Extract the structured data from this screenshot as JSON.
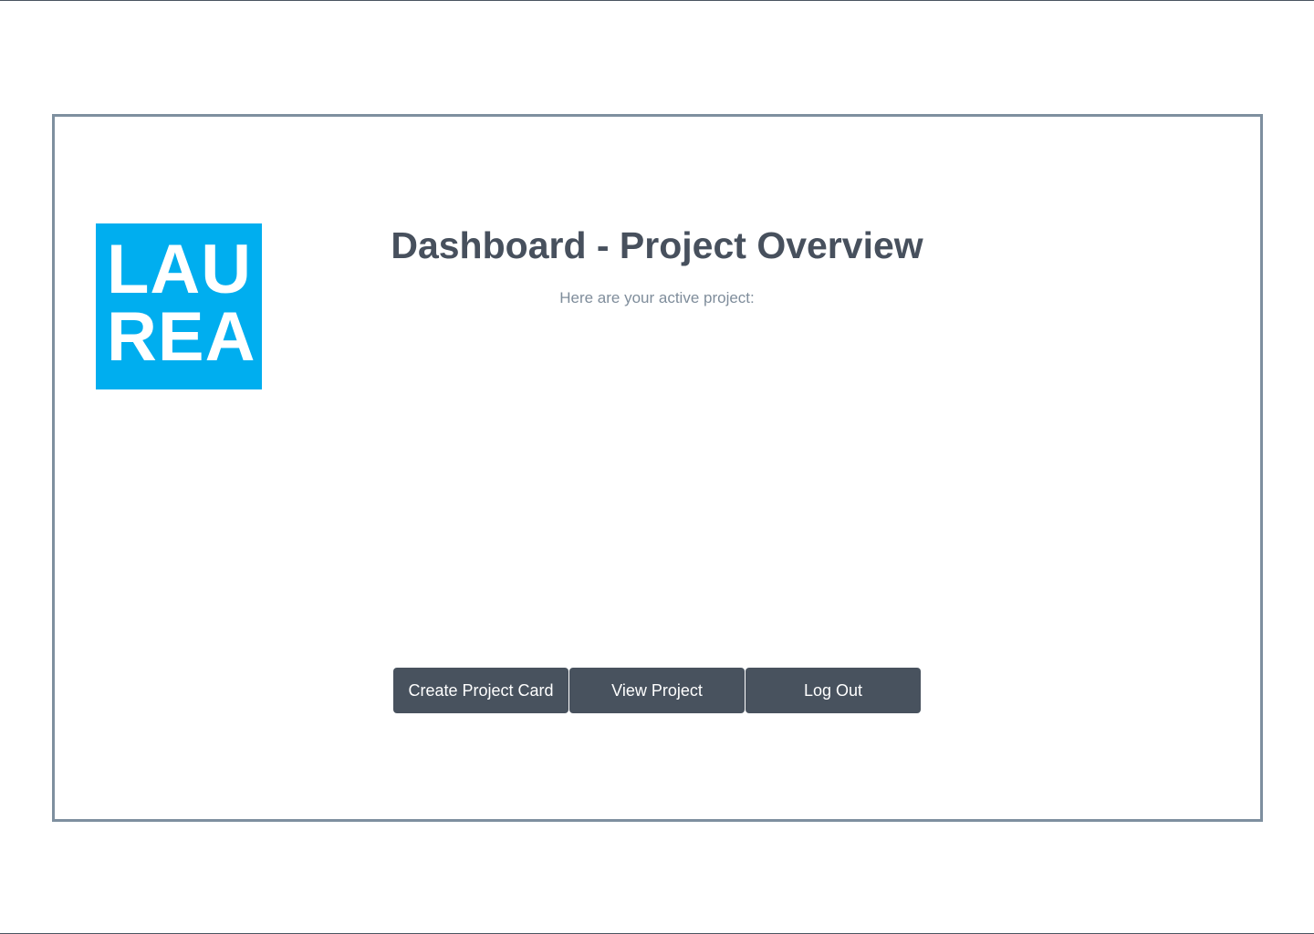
{
  "logo": {
    "line1": "LAU",
    "line2": "REA",
    "color": "#00aeef"
  },
  "header": {
    "title": "Dashboard - Project Overview",
    "subtitle": "Here are your active project:"
  },
  "actions": {
    "create_label": "Create Project Card",
    "view_label": "View Project",
    "logout_label": "Log Out"
  },
  "colors": {
    "button_bg": "#48525e",
    "card_border": "#7e8f9f",
    "title_text": "#47505d",
    "subtitle_text": "#7f8d9b"
  }
}
